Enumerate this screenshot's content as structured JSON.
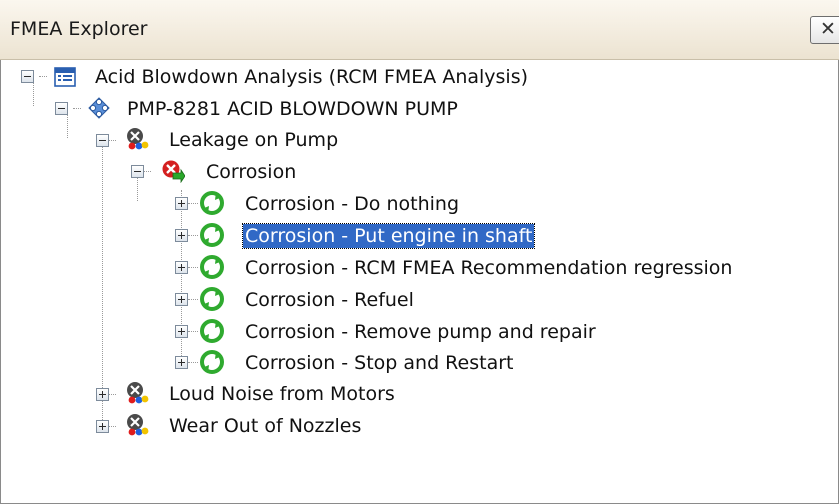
{
  "panel": {
    "title": "FMEA Explorer",
    "close_glyph": "✕"
  },
  "tree": {
    "root": {
      "label": "Acid Blowdown Analysis (RCM FMEA Analysis)",
      "icon": "analysis-table-icon"
    },
    "asset": {
      "label": "PMP-8281 ACID BLOWDOWN PUMP",
      "icon": "asset-diamond-icon"
    },
    "failure_modes": [
      {
        "label": "Leakage on Pump",
        "icon": "failure-mode-icon",
        "expanded": true
      },
      {
        "label": "Loud Noise from Motors",
        "icon": "failure-mode-icon",
        "expanded": false
      },
      {
        "label": "Wear Out of Nozzles",
        "icon": "failure-mode-icon",
        "expanded": false
      }
    ],
    "cause": {
      "label": "Corrosion",
      "icon": "failure-cause-icon"
    },
    "recommendations": [
      {
        "label": "Corrosion - Do nothing"
      },
      {
        "label": "Corrosion - Put engine in shaft",
        "selected": true
      },
      {
        "label": "Corrosion - RCM FMEA Recommendation regression"
      },
      {
        "label": "Corrosion - Refuel"
      },
      {
        "label": "Corrosion - Remove pump and repair"
      },
      {
        "label": "Corrosion - Stop and Restart"
      }
    ],
    "recommendation_icon": "recommendation-cycle-icon"
  },
  "colors": {
    "selection": "#3169c6",
    "titlebar": "#f3eddf",
    "tree_lines": "#9a9a9a"
  }
}
